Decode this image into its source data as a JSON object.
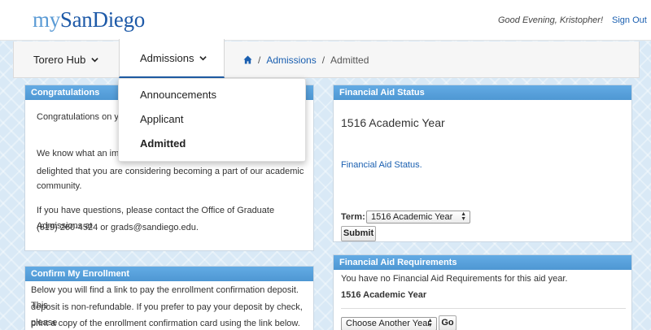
{
  "header": {
    "logo_my": "my",
    "logo_sd": "SanDiego",
    "greeting": "Good Evening, Kristopher!",
    "signout": "Sign Out"
  },
  "nav": {
    "torero": "Torero Hub",
    "admissions": "Admissions",
    "breadcrumb": {
      "sep": "/",
      "section": "Admissions",
      "current": "Admitted"
    }
  },
  "dropdown": {
    "items": [
      "Announcements",
      "Applicant",
      "Admitted"
    ],
    "active": "Admitted"
  },
  "congrats": {
    "title": "Congratulations",
    "line1": "Congratulations on you",
    "line2": "We know what an impo",
    "line3": "delighted that you are considering becoming a part of our academic",
    "line4": "community.",
    "line5": "If you have questions, please contact the Office of Graduate Admissions at",
    "line6": "(619) 260-4524 or grads@sandiego.edu."
  },
  "confirm": {
    "title": "Confirm My Enrollment",
    "line1": "Below you will find a link to pay the enrollment confirmation deposit. This",
    "line2": "deposit is non-refundable. If you prefer to pay your deposit by check, please",
    "line3": "print a copy of the enrollment confirmation card using the link below."
  },
  "aid_status": {
    "title": "Financial Aid Status",
    "year": "1516 Academic Year",
    "link": "Financial Aid Status.",
    "term_label": "Term:",
    "term_value": "1516 Academic Year",
    "submit": "Submit"
  },
  "aid_req": {
    "title": "Financial Aid Requirements",
    "message": "You have no Financial Aid Requirements for this aid year.",
    "year": "1516 Academic Year",
    "select": "Choose Another Year",
    "go": "Go"
  },
  "colors": {
    "panel_header": "#5aa2dc",
    "link": "#1a5fb0",
    "logo_dark": "#1e5aa8",
    "logo_light": "#5b9bd5",
    "nav_underline": "#1f5ea8"
  },
  "icons": [
    "home-icon",
    "chevron-down-icon",
    "select-arrows-icon"
  ]
}
